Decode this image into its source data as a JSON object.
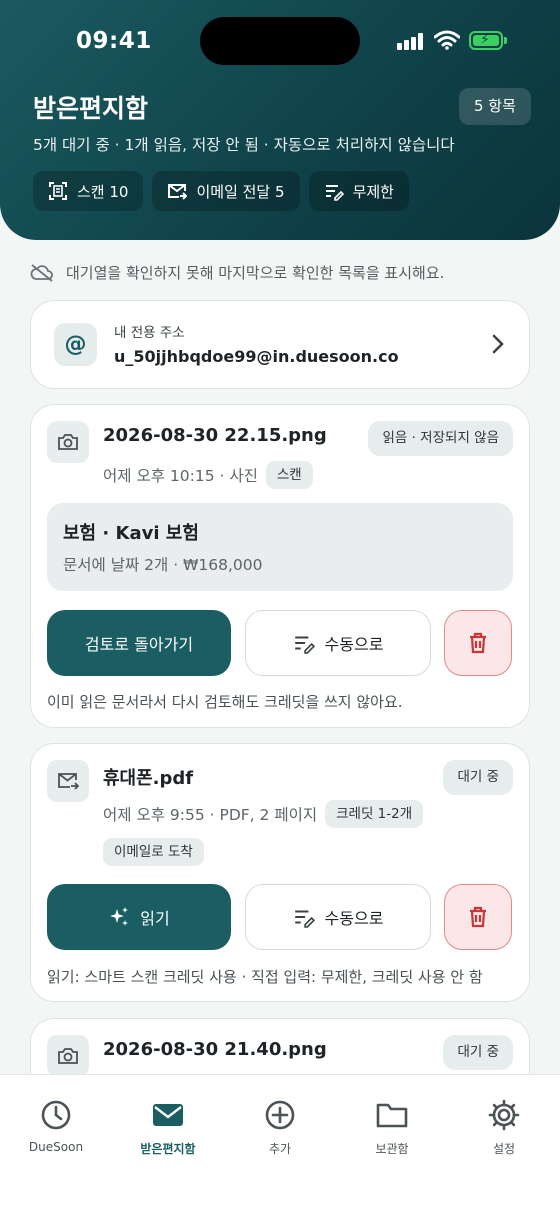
{
  "status_bar": {
    "time": "09:41"
  },
  "header": {
    "title": "받은편지함",
    "count": "5 항목",
    "subtitle": "5개 대기 중 · 1개 읽음, 저장 안 됨 · 자동으로 처리하지 않습니다",
    "chips": [
      {
        "icon": "scan-icon",
        "label": "스캔 10"
      },
      {
        "icon": "email-forward-icon",
        "label": "이메일 전달 5"
      },
      {
        "icon": "manual-edit-icon",
        "label": "무제한"
      }
    ]
  },
  "notice": "대기열을 확인하지 못해 마지막으로 확인한 목록을 표시해요.",
  "address_card": {
    "label": "내 전용 주소",
    "value": "u_50jjhbqdoe99@in.duesoon.co"
  },
  "items": [
    {
      "icon": "camera-icon",
      "name": "2026-08-30 22.15.png",
      "status": "읽음 · 저장되지 않음",
      "meta": "어제 오후 10:15 · 사진",
      "tags": [
        "스캔"
      ],
      "extracted": {
        "title": "보험 · Kavi 보험",
        "detail": "문서에 날짜 2개 · ₩168,000"
      },
      "primary_button": "검토로 돌아가기",
      "secondary_button": "수동으로",
      "helper": "이미 읽은 문서라서 다시 검토해도 크레딧을 쓰지 않아요."
    },
    {
      "icon": "email-forward-icon",
      "name": "휴대폰.pdf",
      "status": "대기 중",
      "meta": "어제 오후 9:55 · PDF, 2 페이지",
      "tags": [
        "크레딧 1-2개",
        "이메일로 도착"
      ],
      "primary_button": "읽기",
      "secondary_button": "수동으로",
      "helper": "읽기: 스마트 스캔 크레딧 사용 · 직접 입력: 무제한, 크레딧 사용 안 함"
    },
    {
      "icon": "camera-icon",
      "name": "2026-08-30 21.40.png",
      "status": "대기 중"
    }
  ],
  "tabbar": [
    {
      "icon": "clock-icon",
      "label": "DueSoon",
      "active": false
    },
    {
      "icon": "mail-icon",
      "label": "받은편지함",
      "active": true
    },
    {
      "icon": "add-circle-icon",
      "label": "추가",
      "active": false
    },
    {
      "icon": "folder-icon",
      "label": "보관함",
      "active": false
    },
    {
      "icon": "gear-icon",
      "label": "설정",
      "active": false
    }
  ],
  "colors": {
    "brand": "#1a5e63",
    "header_dark": "#0f4148",
    "delete_bg": "#fbe7e7",
    "delete_border": "#e08b8b",
    "battery": "#3bd160"
  }
}
